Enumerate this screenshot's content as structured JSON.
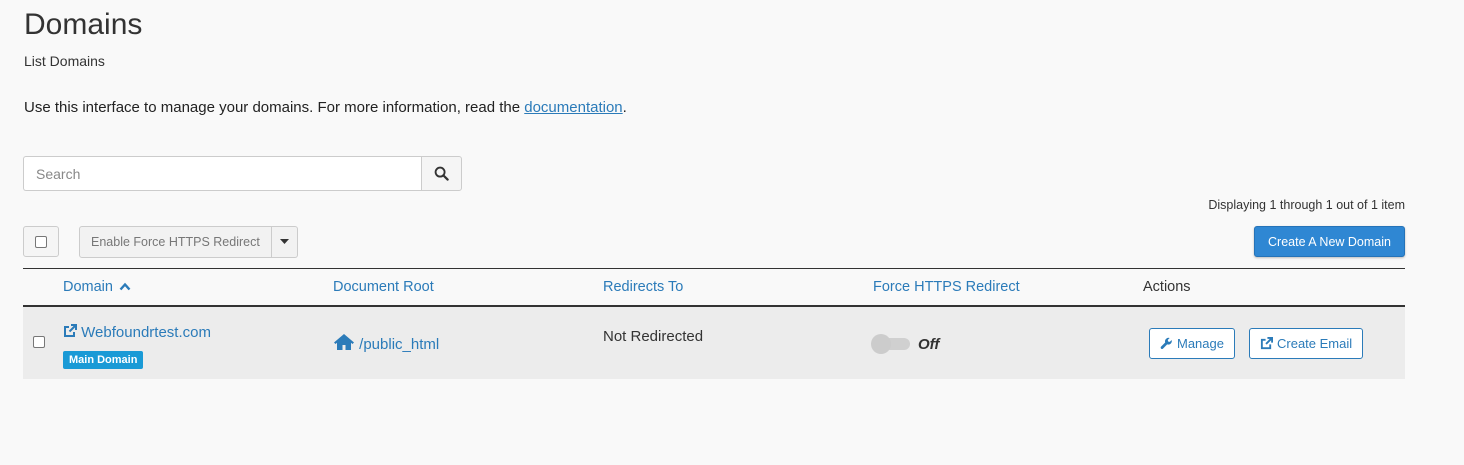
{
  "header": {
    "title": "Domains",
    "subtitle": "List Domains",
    "intro_text": "Use this interface to manage your domains. For more information, read the ",
    "intro_link": "documentation",
    "intro_end": "."
  },
  "search": {
    "placeholder": "Search",
    "icon": "search-icon"
  },
  "toolbar": {
    "bulk_action_label": "Enable Force HTTPS Redirect",
    "create_label": "Create A New Domain",
    "display_count": "Displaying 1 through 1 out of 1 item"
  },
  "table": {
    "columns": [
      "Domain",
      "Document Root",
      "Redirects To",
      "Force HTTPS Redirect",
      "Actions"
    ],
    "rows": [
      {
        "domain": "Webfoundrtest.com",
        "badge": "Main Domain",
        "doc_root": "/public_html",
        "redirects_to": "Not Redirected",
        "https_state": "Off",
        "manage_label": "Manage",
        "email_label": "Create Email"
      }
    ]
  },
  "colors": {
    "accent": "#2b7bb9",
    "primary_button": "#2f87d3",
    "badge": "#1a9ad6"
  }
}
